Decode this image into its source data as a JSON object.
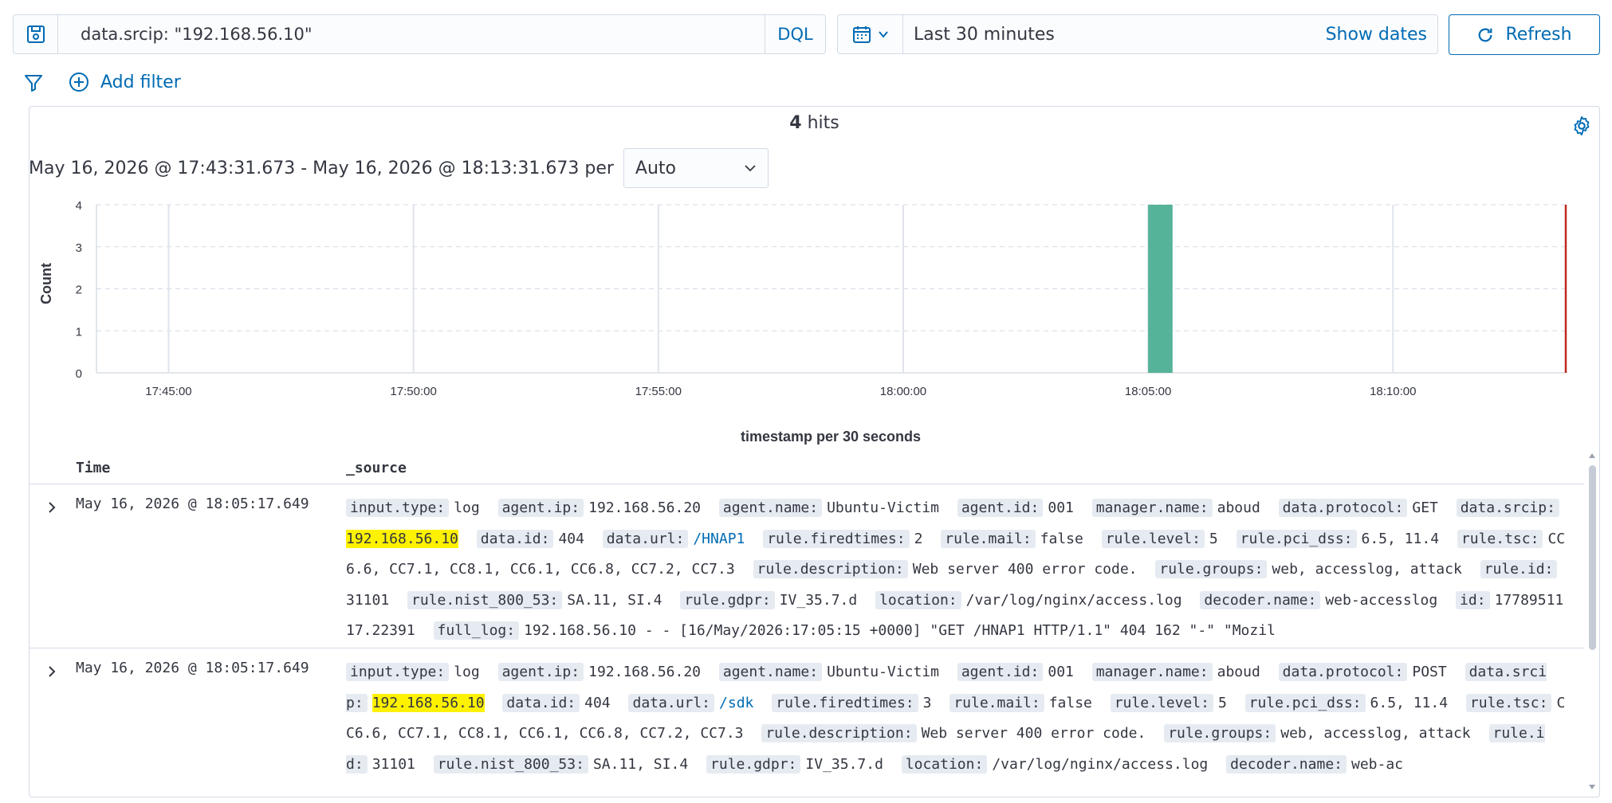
{
  "query": {
    "value": "data.srcip: \"192.168.56.10\"",
    "language": "DQL"
  },
  "date_picker": {
    "label": "Last 30 minutes",
    "show_dates": "Show dates"
  },
  "refresh_label": "Refresh",
  "filter": {
    "add_label": "Add filter"
  },
  "hits": {
    "count": "4",
    "label": "hits"
  },
  "time_range": {
    "text": "May 16, 2026 @ 17:43:31.673 - May 16, 2026 @ 18:13:31.673 per",
    "interval": "Auto"
  },
  "colors": {
    "bar": "#54b399",
    "now_marker": "#bd271e",
    "link": "#006bb4"
  },
  "chart_data": {
    "type": "bar",
    "title": "",
    "xlabel": "timestamp per 30 seconds",
    "ylabel": "Count",
    "ylim": [
      0,
      4
    ],
    "y_ticks": [
      "0",
      "1",
      "2",
      "3",
      "4"
    ],
    "x_range": [
      "17:43:31.673",
      "18:13:31.673"
    ],
    "x_ticks": [
      "17:45:00",
      "17:50:00",
      "17:55:00",
      "18:00:00",
      "18:05:00",
      "18:10:00"
    ],
    "bins": [
      {
        "start": "18:05:00",
        "end": "18:05:30",
        "value": 4
      }
    ],
    "grid": true,
    "now_marker": "18:13:31.673"
  },
  "table": {
    "columns": [
      "Time",
      "_source"
    ],
    "rows": [
      {
        "time": "May 16, 2026 @ 18:05:17.649",
        "fields": [
          {
            "k": "input.type:",
            "v": "log"
          },
          {
            "k": "agent.ip:",
            "v": "192.168.56.20"
          },
          {
            "k": "agent.name:",
            "v": "Ubuntu-Victim"
          },
          {
            "k": "agent.id:",
            "v": "001"
          },
          {
            "k": "manager.name:",
            "v": "aboud"
          },
          {
            "k": "data.protocol:",
            "v": "GET"
          },
          {
            "k": "data.srcip:",
            "v": "192.168.56.10",
            "highlight": true
          },
          {
            "k": "data.id:",
            "v": "404"
          },
          {
            "k": "data.url:",
            "v": "/HNAP1",
            "link": true
          },
          {
            "k": "rule.firedtimes:",
            "v": "2"
          },
          {
            "k": "rule.mail:",
            "v": "false"
          },
          {
            "k": "rule.level:",
            "v": "5"
          },
          {
            "k": "rule.pci_dss:",
            "v": "6.5, 11.4"
          },
          {
            "k": "rule.tsc:",
            "v": "CC6.6, CC7.1, CC8.1, CC6.1, CC6.8, CC7.2, CC7.3"
          },
          {
            "k": "rule.description:",
            "v": "Web server 400 error code."
          },
          {
            "k": "rule.groups:",
            "v": "web, accesslog, attack"
          },
          {
            "k": "rule.id:",
            "v": "31101"
          },
          {
            "k": "rule.nist_800_53:",
            "v": "SA.11, SI.4"
          },
          {
            "k": "rule.gdpr:",
            "v": "IV_35.7.d"
          },
          {
            "k": "location:",
            "v": "/var/log/nginx/access.log"
          },
          {
            "k": "decoder.name:",
            "v": "web-accesslog"
          },
          {
            "k": "id:",
            "v": "1778951117.22391"
          },
          {
            "k": "full_log:",
            "v": "192.168.56.10 - - [16/May/2026:17:05:15 +0000] \"GET /HNAP1 HTTP/1.1\" 404 162 \"-\" \"Mozil"
          }
        ]
      },
      {
        "time": "May 16, 2026 @ 18:05:17.649",
        "fields": [
          {
            "k": "input.type:",
            "v": "log"
          },
          {
            "k": "agent.ip:",
            "v": "192.168.56.20"
          },
          {
            "k": "agent.name:",
            "v": "Ubuntu-Victim"
          },
          {
            "k": "agent.id:",
            "v": "001"
          },
          {
            "k": "manager.name:",
            "v": "aboud"
          },
          {
            "k": "data.protocol:",
            "v": "POST"
          },
          {
            "k": "data.srcip:",
            "v": "192.168.56.10",
            "highlight": true
          },
          {
            "k": "data.id:",
            "v": "404"
          },
          {
            "k": "data.url:",
            "v": "/sdk",
            "link": true
          },
          {
            "k": "rule.firedtimes:",
            "v": "3"
          },
          {
            "k": "rule.mail:",
            "v": "false"
          },
          {
            "k": "rule.level:",
            "v": "5"
          },
          {
            "k": "rule.pci_dss:",
            "v": "6.5, 11.4"
          },
          {
            "k": "rule.tsc:",
            "v": "CC6.6, CC7.1, CC8.1, CC6.1, CC6.8, CC7.2, CC7.3"
          },
          {
            "k": "rule.description:",
            "v": "Web server 400 error code."
          },
          {
            "k": "rule.groups:",
            "v": "web, accesslog, attack"
          },
          {
            "k": "rule.id:",
            "v": "31101"
          },
          {
            "k": "rule.nist_800_53:",
            "v": "SA.11, SI.4"
          },
          {
            "k": "rule.gdpr:",
            "v": "IV_35.7.d"
          },
          {
            "k": "location:",
            "v": "/var/log/nginx/access.log"
          },
          {
            "k": "decoder.name:",
            "v": "web-ac"
          }
        ]
      }
    ]
  }
}
